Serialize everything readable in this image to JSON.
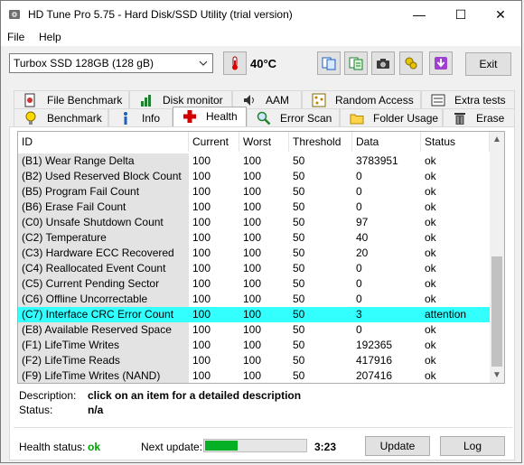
{
  "window": {
    "title": "HD Tune Pro 5.75 - Hard Disk/SSD Utility (trial version)"
  },
  "menu": {
    "file": "File",
    "help": "Help"
  },
  "toolbar": {
    "drive": "Turbox SSD 128GB (128 gB)",
    "temperature": "40°C",
    "exit_label": "Exit",
    "icons": [
      "copy-info-icon",
      "copy-text-icon",
      "camera-icon",
      "options-icon",
      "download-icon"
    ]
  },
  "tabs_row1": [
    {
      "label": "File Benchmark",
      "icon": "file-benchmark-icon"
    },
    {
      "label": "Disk monitor",
      "icon": "disk-monitor-icon"
    },
    {
      "label": "AAM",
      "icon": "speaker-icon"
    },
    {
      "label": "Random Access",
      "icon": "random-access-icon"
    },
    {
      "label": "Extra tests",
      "icon": "extra-tests-icon"
    }
  ],
  "tabs_row2": [
    {
      "label": "Benchmark",
      "icon": "bulb-icon"
    },
    {
      "label": "Info",
      "icon": "info-icon"
    },
    {
      "label": "Health",
      "icon": "health-cross-icon",
      "active": true
    },
    {
      "label": "Error Scan",
      "icon": "magnifier-icon"
    },
    {
      "label": "Folder Usage",
      "icon": "folder-icon"
    },
    {
      "label": "Erase",
      "icon": "trash-icon"
    }
  ],
  "table": {
    "headers": [
      "ID",
      "Current",
      "Worst",
      "Threshold",
      "Data",
      "Status"
    ],
    "rows": [
      [
        "(B1) Wear Range Delta",
        "100",
        "100",
        "50",
        "3783951",
        "ok"
      ],
      [
        "(B2) Used Reserved Block Count",
        "100",
        "100",
        "50",
        "0",
        "ok"
      ],
      [
        "(B5) Program Fail Count",
        "100",
        "100",
        "50",
        "0",
        "ok"
      ],
      [
        "(B6) Erase Fail Count",
        "100",
        "100",
        "50",
        "0",
        "ok"
      ],
      [
        "(C0) Unsafe Shutdown Count",
        "100",
        "100",
        "50",
        "97",
        "ok"
      ],
      [
        "(C2) Temperature",
        "100",
        "100",
        "50",
        "40",
        "ok"
      ],
      [
        "(C3) Hardware ECC Recovered",
        "100",
        "100",
        "50",
        "20",
        "ok"
      ],
      [
        "(C4) Reallocated Event Count",
        "100",
        "100",
        "50",
        "0",
        "ok"
      ],
      [
        "(C5) Current Pending Sector",
        "100",
        "100",
        "50",
        "0",
        "ok"
      ],
      [
        "(C6) Offline Uncorrectable",
        "100",
        "100",
        "50",
        "0",
        "ok"
      ],
      [
        "(C7) Interface CRC Error Count",
        "100",
        "100",
        "50",
        "3",
        "attention"
      ],
      [
        "(E8) Available Reserved Space",
        "100",
        "100",
        "50",
        "0",
        "ok"
      ],
      [
        "(F1) LifeTime Writes",
        "100",
        "100",
        "50",
        "192365",
        "ok"
      ],
      [
        "(F2) LifeTime Reads",
        "100",
        "100",
        "50",
        "417916",
        "ok"
      ],
      [
        "(F9) LifeTime Writes (NAND)",
        "100",
        "100",
        "50",
        "207416",
        "ok"
      ]
    ],
    "selected_index": 10,
    "selected_color": "#33ffff"
  },
  "details": {
    "description_label": "Description:",
    "description_value": "click on an item for a detailed description",
    "status_label": "Status:",
    "status_value": "n/a"
  },
  "footer": {
    "health_label": "Health status:",
    "health_value": "ok",
    "health_color": "#00a000",
    "next_update_label": "Next update:",
    "progress_fraction": 0.32,
    "time": "3:23",
    "update_label": "Update",
    "log_label": "Log"
  }
}
